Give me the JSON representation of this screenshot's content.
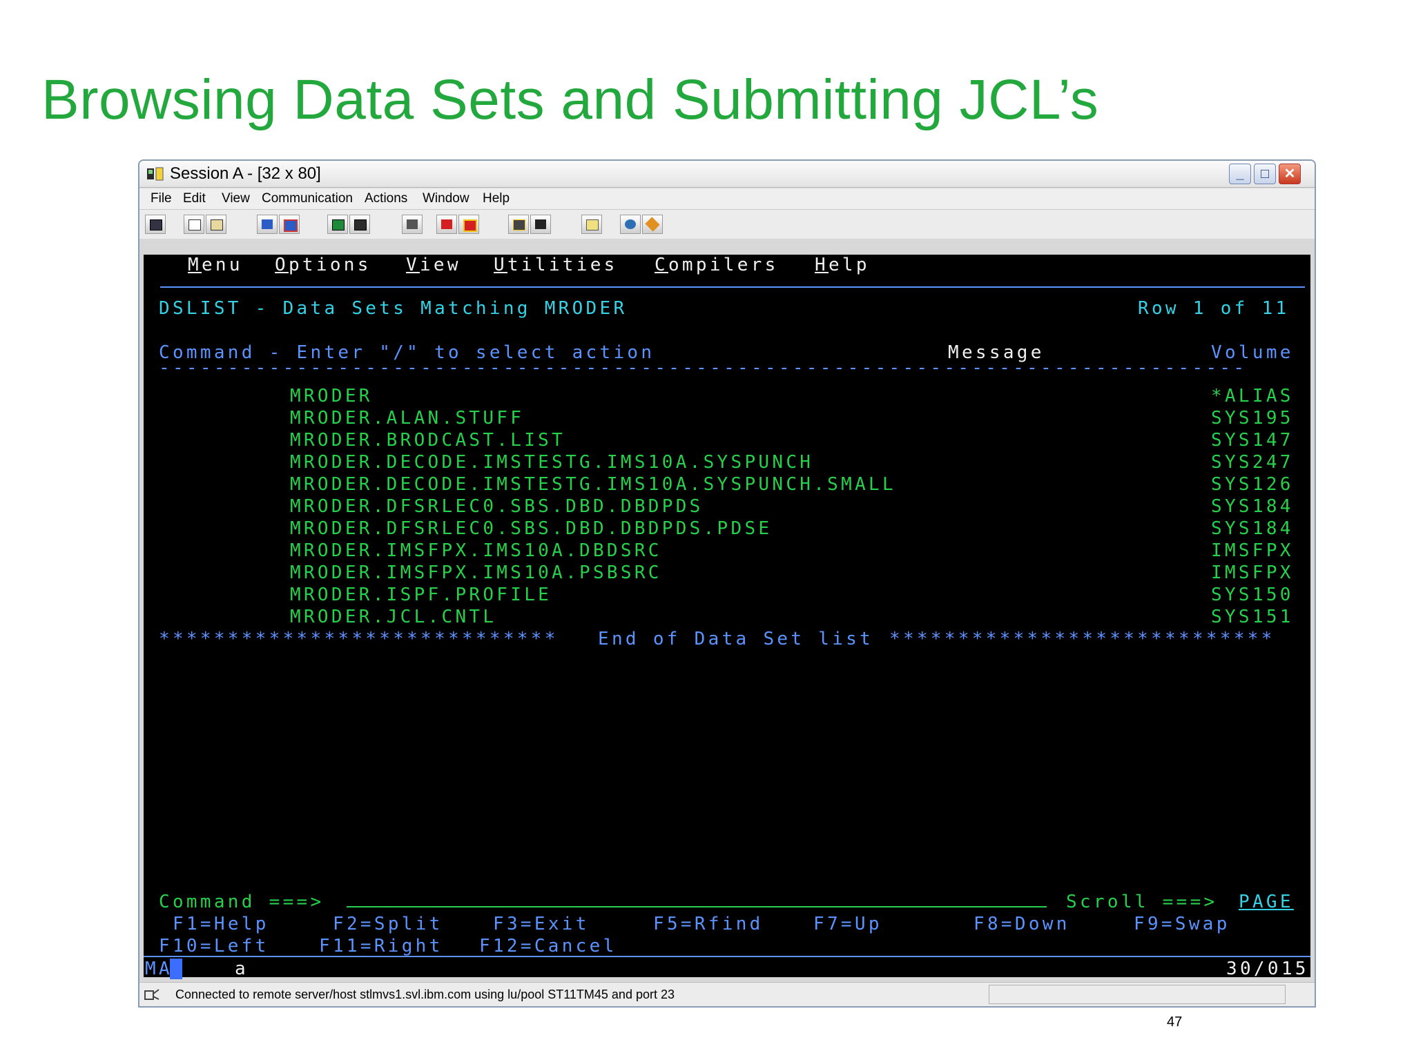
{
  "slide": {
    "title": "Browsing Data Sets and Submitting JCL’s",
    "page_number": "47"
  },
  "window": {
    "title": "Session A - [32 x 80]",
    "menu": [
      "File",
      "Edit",
      "View",
      "Communication",
      "Actions",
      "Window",
      "Help"
    ]
  },
  "terminal": {
    "action_bar": [
      "Menu",
      "Options",
      "View",
      "Utilities",
      "Compilers",
      "Help"
    ],
    "panel_title": "DSLIST - Data Sets Matching MRODER",
    "row_info": "Row 1 of 11",
    "command_header": "Command - Enter \"/\" to select action",
    "message_header": "Message",
    "volume_header": "Volume",
    "divider": "-------------------------------------------------------------------------------",
    "datasets": [
      {
        "name": "MRODER",
        "volume": "*ALIAS"
      },
      {
        "name": "MRODER.ALAN.STUFF",
        "volume": "SYS195"
      },
      {
        "name": "MRODER.BRODCAST.LIST",
        "volume": "SYS147"
      },
      {
        "name": "MRODER.DECODE.IMSTESTG.IMS10A.SYSPUNCH",
        "volume": "SYS247"
      },
      {
        "name": "MRODER.DECODE.IMSTESTG.IMS10A.SYSPUNCH.SMALL",
        "volume": "SYS126"
      },
      {
        "name": "MRODER.DFSRLEC0.SBS.DBD.DBDPDS",
        "volume": "SYS184"
      },
      {
        "name": "MRODER.DFSRLEC0.SBS.DBD.DBDPDS.PDSE",
        "volume": "SYS184"
      },
      {
        "name": "MRODER.IMSFPX.IMS10A.DBDSRC",
        "volume": "IMSFPX"
      },
      {
        "name": "MRODER.IMSFPX.IMS10A.PSBSRC",
        "volume": "IMSFPX"
      },
      {
        "name": "MRODER.ISPF.PROFILE",
        "volume": "SYS150"
      },
      {
        "name": "MRODER.JCL.CNTL",
        "volume": "SYS151"
      }
    ],
    "end_stars_left": "*****************************",
    "end_text": "End of Data Set list",
    "end_stars_right": "****************************",
    "command_prompt": "Command ===>",
    "command_value": "",
    "scroll_prompt": "Scroll ===>",
    "scroll_value": "PAGE",
    "fkeys_row1": [
      "F1=Help",
      "F2=Split",
      "F3=Exit",
      "F5=Rfind",
      "F7=Up",
      "F8=Down",
      "F9=Swap"
    ],
    "fkeys_row2": [
      "F10=Left",
      "F11=Right",
      "F12=Cancel"
    ],
    "oia_left": "MA",
    "oia_mid": "a",
    "cursor_pos": "30/015"
  },
  "status": {
    "text": "Connected to remote server/host stlmvs1.svl.ibm.com using lu/pool ST11TM45 and port 23"
  }
}
